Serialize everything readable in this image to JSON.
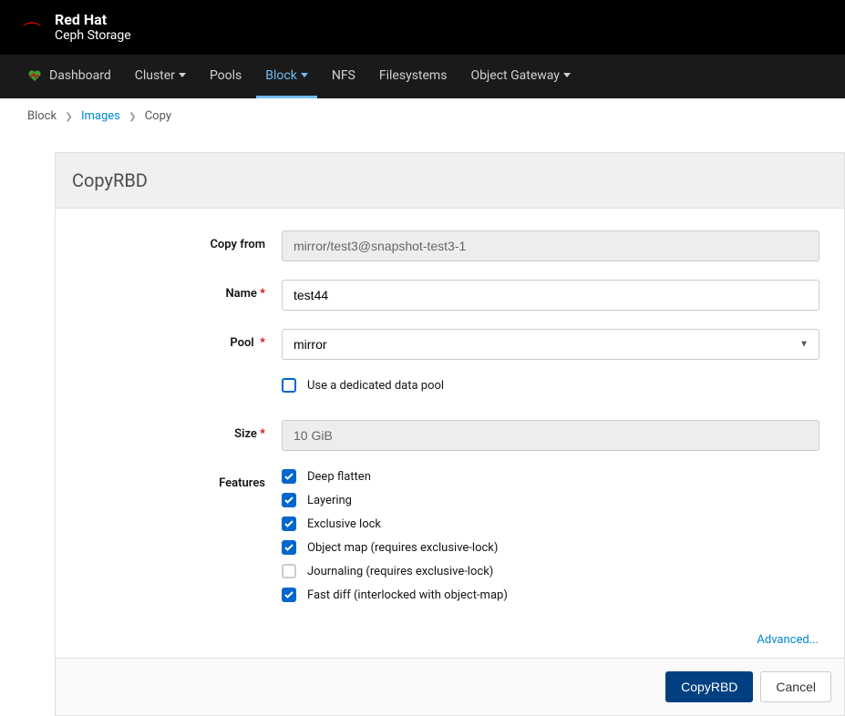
{
  "brand": {
    "line1": "Red Hat",
    "line2": "Ceph Storage"
  },
  "nav": {
    "dashboard": "Dashboard",
    "cluster": "Cluster",
    "pools": "Pools",
    "block": "Block",
    "nfs": "NFS",
    "filesystems": "Filesystems",
    "objectgw": "Object Gateway"
  },
  "breadcrumb": {
    "root": "Block",
    "mid": "Images",
    "leaf": "Copy"
  },
  "panel": {
    "title": "CopyRBD"
  },
  "form": {
    "copyfrom": {
      "label": "Copy from",
      "value": "mirror/test3@snapshot-test3-1"
    },
    "name": {
      "label": "Name",
      "value": "test44"
    },
    "pool": {
      "label": "Pool",
      "value": "mirror"
    },
    "dedicated": {
      "label": "Use a dedicated data pool",
      "checked": false
    },
    "size": {
      "label": "Size",
      "value": "10 GiB"
    },
    "features": {
      "label": "Features",
      "items": [
        {
          "label": "Deep flatten",
          "checked": true
        },
        {
          "label": "Layering",
          "checked": true
        },
        {
          "label": "Exclusive lock",
          "checked": true
        },
        {
          "label": "Object map (requires exclusive-lock)",
          "checked": true
        },
        {
          "label": "Journaling (requires exclusive-lock)",
          "checked": false
        },
        {
          "label": "Fast diff (interlocked with object-map)",
          "checked": true
        }
      ]
    },
    "advanced": "Advanced..."
  },
  "buttons": {
    "submit": "CopyRBD",
    "cancel": "Cancel"
  }
}
